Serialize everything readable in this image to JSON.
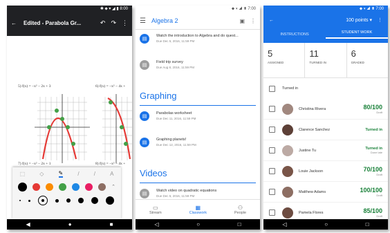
{
  "phone1": {
    "status_time": "8:00",
    "title": "Edited - Parabola Gr...",
    "equations": [
      "5) f(x) = −x² − 2x + 3",
      "6) f(x) = −x² − 4x +",
      "7) f(x) = −x² − 2x + 1",
      "8) f(x) = −x² − 4x +"
    ],
    "icons": [
      "back-arrow-icon",
      "undo-icon",
      "redo-icon",
      "more-vert-icon"
    ],
    "colors": [
      "#000000",
      "#e53935",
      "#fb8c00",
      "#43a047",
      "#1e88e5",
      "#e91e63",
      "#8d6e63"
    ]
  },
  "phone2": {
    "status_time": "7:00",
    "title": "Algebra 2",
    "items_top": [
      {
        "title": "Watch the introduction to Algebra and do quest...",
        "due": "Due Dec 5, 2016, 11:59 PM",
        "color": "#1a73e8"
      },
      {
        "title": "Field trip survey",
        "due": "Due Aug 8, 2016, 11:59 PM",
        "color": "#9e9e9e"
      }
    ],
    "section_graphing": "Graphing",
    "items_graphing": [
      {
        "title": "Parabolas worksheet",
        "due": "Due Dec 11, 2016, 11:59 PM",
        "color": "#1a73e8"
      },
      {
        "title": "Graphing planets!",
        "due": "Due Dec 12, 2016, 11:59 PM",
        "color": "#1a73e8"
      }
    ],
    "section_videos": "Videos",
    "items_videos": [
      {
        "title": "Watch video on quadratic equations",
        "due": "Due Dec 5, 2016, 11:59 PM",
        "color": "#9e9e9e"
      }
    ],
    "nav": {
      "stream": "Stream",
      "classwork": "Classwork",
      "people": "People"
    }
  },
  "phone3": {
    "status_time": "7:00",
    "points": "100 points",
    "tabs": {
      "instructions": "INSTRUCTIONS",
      "student_work": "STUDENT WORK"
    },
    "stats": [
      {
        "num": "5",
        "label": "ASSIGNED"
      },
      {
        "num": "11",
        "label": "TURNED IN"
      },
      {
        "num": "6",
        "label": "GRADED"
      }
    ],
    "turned_in_label": "Turned in",
    "students": [
      {
        "name": "Christina Rivera",
        "grade": "80/100",
        "sub": "Draft"
      },
      {
        "name": "Clarence Sanchez",
        "grade": "",
        "status": "Turned in"
      },
      {
        "name": "Justine Tu",
        "grade": "",
        "status": "Turned in",
        "sub": "Done late"
      },
      {
        "name": "Louie Jackson",
        "grade": "70/100",
        "sub": "Draft"
      },
      {
        "name": "Matthew Adams",
        "grade": "100/100",
        "sub": "Draft"
      },
      {
        "name": "Pamela Flores",
        "grade": "85/100",
        "sub": "Draft"
      }
    ]
  }
}
